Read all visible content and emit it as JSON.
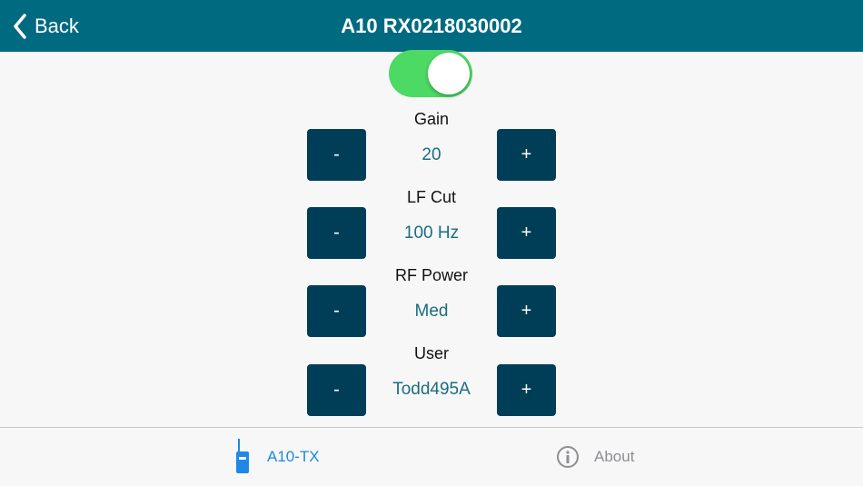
{
  "header": {
    "back_label": "Back",
    "title": "A10 RX0218030002"
  },
  "toggle": {
    "state": "on",
    "color": "#4cd964"
  },
  "controls": [
    {
      "label": "Gain",
      "value": "20",
      "minus": "-",
      "plus": "+"
    },
    {
      "label": "LF Cut",
      "value": "100 Hz",
      "minus": "-",
      "plus": "+"
    },
    {
      "label": "RF Power",
      "value": "Med",
      "minus": "-",
      "plus": "+"
    },
    {
      "label": "User",
      "value": "Todd495A",
      "minus": "-",
      "plus": "+"
    }
  ],
  "tabs": [
    {
      "label": "A10-TX",
      "icon": "transmitter-icon",
      "active": true
    },
    {
      "label": "About",
      "icon": "info-icon",
      "active": false
    }
  ],
  "colors": {
    "nav": "#006a80",
    "button": "#003e58",
    "value_text": "#1a6d80",
    "tab_active": "#1e88e5",
    "tab_inactive": "#8e8e93"
  }
}
